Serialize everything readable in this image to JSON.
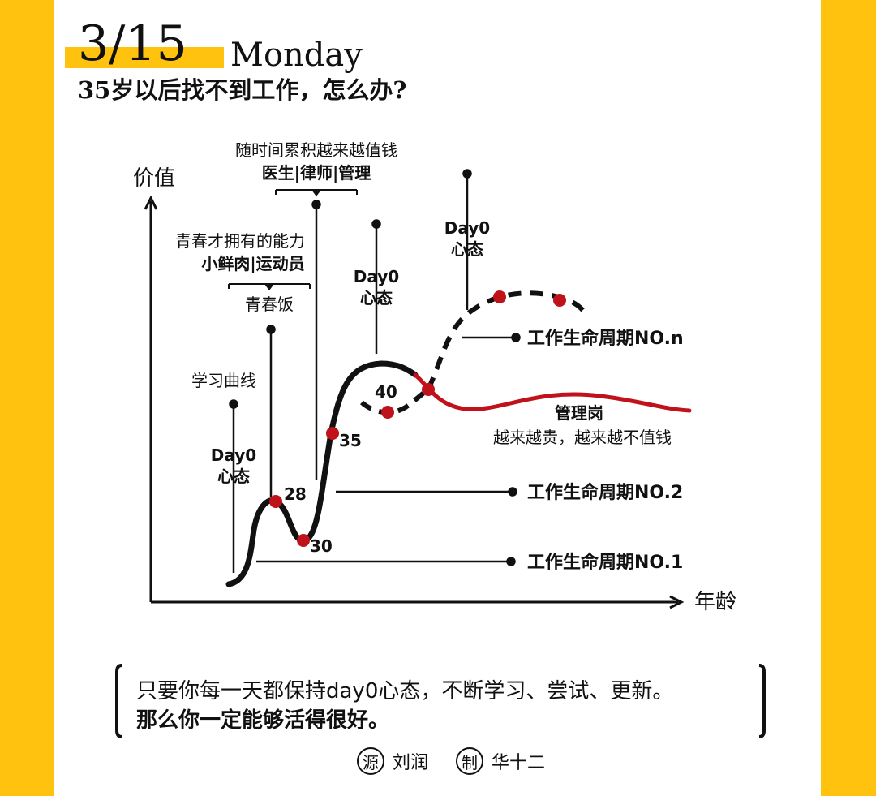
{
  "header": {
    "date": "3/15",
    "weekday": "Monday",
    "question": "35岁以后找不到工作，怎么办?"
  },
  "axes": {
    "y_label": "价值",
    "x_label": "年龄"
  },
  "annotations": {
    "learning_curve": "学习曲线",
    "day0_mindset_1": [
      "Day0",
      "心态"
    ],
    "youth_heading": "青春饭",
    "youth_desc": "青春才拥有的能力",
    "youth_examples": "小鲜肉|运动员",
    "value_desc": "随时间累积越来越值钱",
    "value_examples": "医生|律师|管理",
    "day0_mindset_2": [
      "Day0",
      "心态"
    ],
    "day0_mindset_3": [
      "Day0",
      "心态"
    ],
    "manager_title": "管理岗",
    "manager_desc": "越来越贵，越来越不值钱"
  },
  "age_points": [
    "28",
    "30",
    "35",
    "40"
  ],
  "cycles": [
    "工作生命周期NO.n",
    "工作生命周期NO.2",
    "工作生命周期NO.1"
  ],
  "colors": {
    "accent": "#FFC20E",
    "curve": "#111111",
    "decline": "#C0121A",
    "point": "#C0121A"
  },
  "quote": {
    "line1": "只要你每一天都保持day0心态，不断学习、尝试、更新。",
    "line2": "那么你一定能够活得很好。"
  },
  "credits": {
    "source_badge": "源",
    "source_name": "刘润",
    "maker_badge": "制",
    "maker_name": "华十二"
  }
}
